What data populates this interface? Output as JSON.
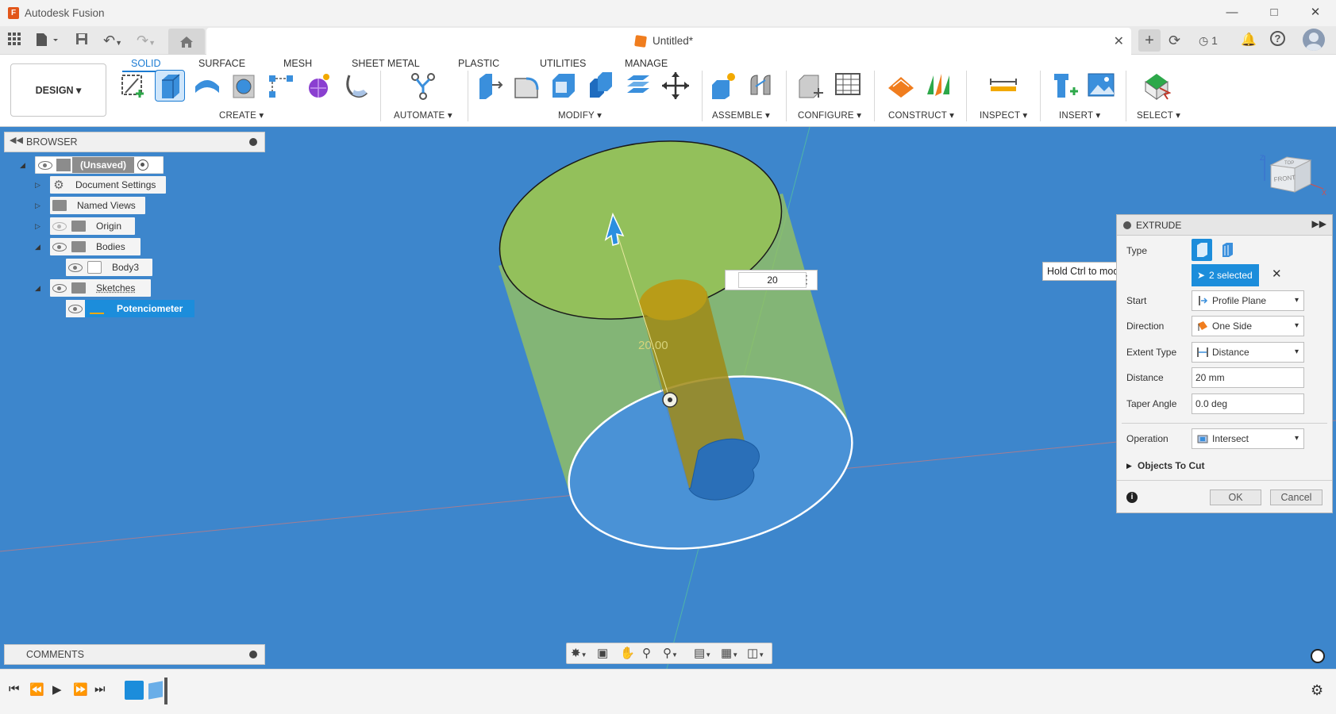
{
  "window": {
    "title": "Autodesk Fusion",
    "logo_letter": "F"
  },
  "tabs": {
    "document_title": "Untitled*",
    "job_count": "1"
  },
  "ribbon": {
    "workspace": "DESIGN ▾",
    "tabs": [
      "SOLID",
      "SURFACE",
      "MESH",
      "SHEET METAL",
      "PLASTIC",
      "UTILITIES",
      "MANAGE"
    ],
    "active_tab": "SOLID",
    "groups": [
      "CREATE ▾",
      "AUTOMATE ▾",
      "MODIFY ▾",
      "ASSEMBLE ▾",
      "CONFIGURE ▾",
      "CONSTRUCT ▾",
      "INSPECT ▾",
      "INSERT ▾",
      "SELECT ▾"
    ]
  },
  "browser": {
    "title": "BROWSER",
    "items": [
      {
        "label": "(Unsaved)"
      },
      {
        "label": "Document Settings"
      },
      {
        "label": "Named Views"
      },
      {
        "label": "Origin"
      },
      {
        "label": "Bodies"
      },
      {
        "label": "Body3"
      },
      {
        "label": "Sketches"
      },
      {
        "label": "Potenciometer"
      }
    ]
  },
  "comments": {
    "title": "COMMENTS"
  },
  "viewcube": {
    "top": "TOP",
    "front": "FRONT",
    "axis_x": "X",
    "axis_y": "Y",
    "axis_z": "Z"
  },
  "viewport": {
    "dimension_label": "20.00",
    "dimension_input": "20"
  },
  "extrude": {
    "title": "EXTRUDE",
    "tooltip": "Hold Ctrl to modify selection",
    "type_label": "Type",
    "selection": "2 selected",
    "fields": {
      "start_label": "Start",
      "start_value": "Profile Plane",
      "direction_label": "Direction",
      "direction_value": "One Side",
      "extent_label": "Extent Type",
      "extent_value": "Distance",
      "distance_label": "Distance",
      "distance_value": "20 mm",
      "taper_label": "Taper Angle",
      "taper_value": "0.0 deg",
      "operation_label": "Operation",
      "operation_value": "Intersect"
    },
    "objects_to_cut": "Objects To Cut",
    "ok": "OK",
    "cancel": "Cancel"
  },
  "colors": {
    "accent": "#1b7bd3",
    "viewport_bg": "#3d86cc",
    "body_green": "#9bc45a",
    "selection_blue": "#1c8ddb"
  }
}
